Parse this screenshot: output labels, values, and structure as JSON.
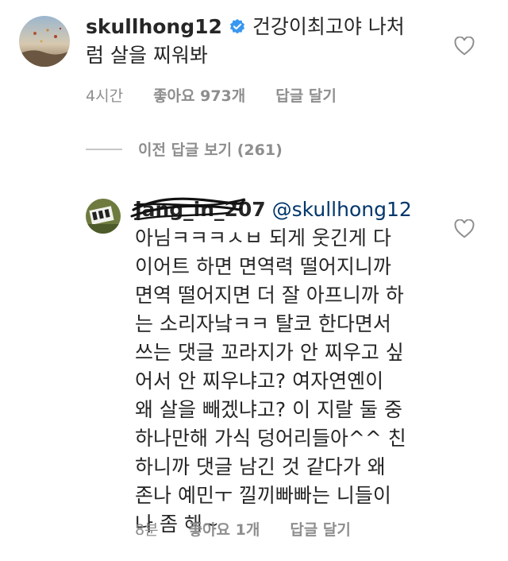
{
  "comment1": {
    "username": "skullhong12",
    "text_line1": "건강이최고야 나처",
    "text_line2": "럼 살을 찌워봐",
    "time": "4시간",
    "likes": "좋아요 973개",
    "reply": "답글 달기"
  },
  "replies": {
    "view_label": "이전 답글 보기 (261)"
  },
  "comment2": {
    "username": "jang_in_207",
    "mention": "@skullhong12",
    "lines": [
      "아님ㅋㅋㅋㅅㅂ 되게 웃긴게 다",
      "이어트 하면 면역력 떨어지니까",
      "면역 떨어지면 더 잘 아프니까 하",
      "는 소리자낰ㅋㅋ 탈코 한다면서",
      "쓰는 댓글 꼬라지가 안 찌우고 싶",
      "어서 안 찌우냐고? 여자연옌이",
      "왜 살을 빼겠냐고? 이 지랄 둘 중",
      "하나만해 가식 덩어리들아^^ 친",
      "하니까 댓글 남긴 것 같다가 왜",
      "존나 예민ㅜ 낄끼빠빠는 니들이",
      "나 좀 해~"
    ],
    "time": "8분",
    "likes": "좋아요 1개",
    "reply": "답글 달기"
  },
  "colors": {
    "verified": "#3897f0",
    "secondary": "#8e8e8e",
    "text": "#262626"
  }
}
